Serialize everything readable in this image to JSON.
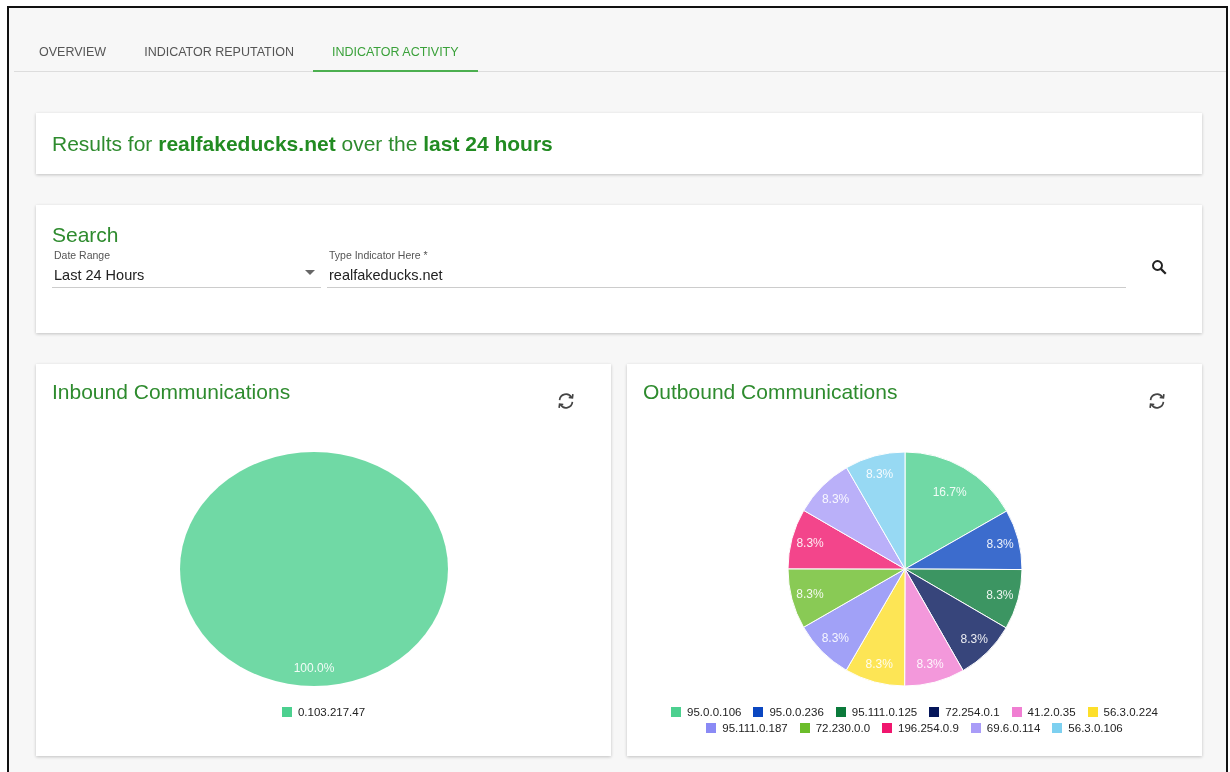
{
  "tabs": [
    {
      "label": "OVERVIEW",
      "selected": false
    },
    {
      "label": "INDICATOR REPUTATION",
      "selected": false
    },
    {
      "label": "INDICATOR ACTIVITY",
      "selected": true
    }
  ],
  "results_banner": {
    "text": "Results for **realfakeducks.net** over the **last 24 hours**"
  },
  "search": {
    "title": "Search",
    "date_range": {
      "label": "Date Range",
      "value": "Last 24 Hours"
    },
    "indicator": {
      "label": "Type Indicator Here *",
      "value": "realfakeducks.net"
    }
  },
  "panels": [
    {
      "title": "Inbound Communications",
      "chart_data": {
        "type": "pie",
        "values": [
          100
        ],
        "value_labels": [
          "100.0%"
        ]
      },
      "legend": [
        {
          "label": "0.103.217.47",
          "color": "#4cd08f"
        }
      ]
    },
    {
      "title": "Outbound Communications",
      "chart_data": {
        "type": "pie",
        "values": [
          16.7,
          8.3,
          8.3,
          8.3,
          8.3,
          8.3,
          8.3,
          8.3,
          8.3,
          8.3,
          8.3
        ],
        "value_labels": [
          "16.7%",
          "8.3%",
          "8.3%",
          "8.3%",
          "8.3%",
          "8.3%",
          "8.3%",
          "8.3%",
          "8.3%",
          "8.3%",
          "8.3%"
        ]
      },
      "legend": [
        {
          "label": "95.0.0.106",
          "color": "#4cd08f"
        },
        {
          "label": "95.0.0.236",
          "color": "#0b47c1"
        },
        {
          "label": "95.111.0.125",
          "color": "#0b7a3b"
        },
        {
          "label": "72.254.0.1",
          "color": "#05165a"
        },
        {
          "label": "41.2.0.35",
          "color": "#f07ed2"
        },
        {
          "label": "56.3.0.224",
          "color": "#fddf2a"
        },
        {
          "label": "95.111.0.187",
          "color": "#8a8af5"
        },
        {
          "label": "72.230.0.0",
          "color": "#6bbd2a"
        },
        {
          "label": "196.254.0.9",
          "color": "#f0166e"
        },
        {
          "label": "69.6.0.114",
          "color": "#a99cf8"
        },
        {
          "label": "56.3.0.106",
          "color": "#7dd0f0"
        }
      ]
    }
  ]
}
